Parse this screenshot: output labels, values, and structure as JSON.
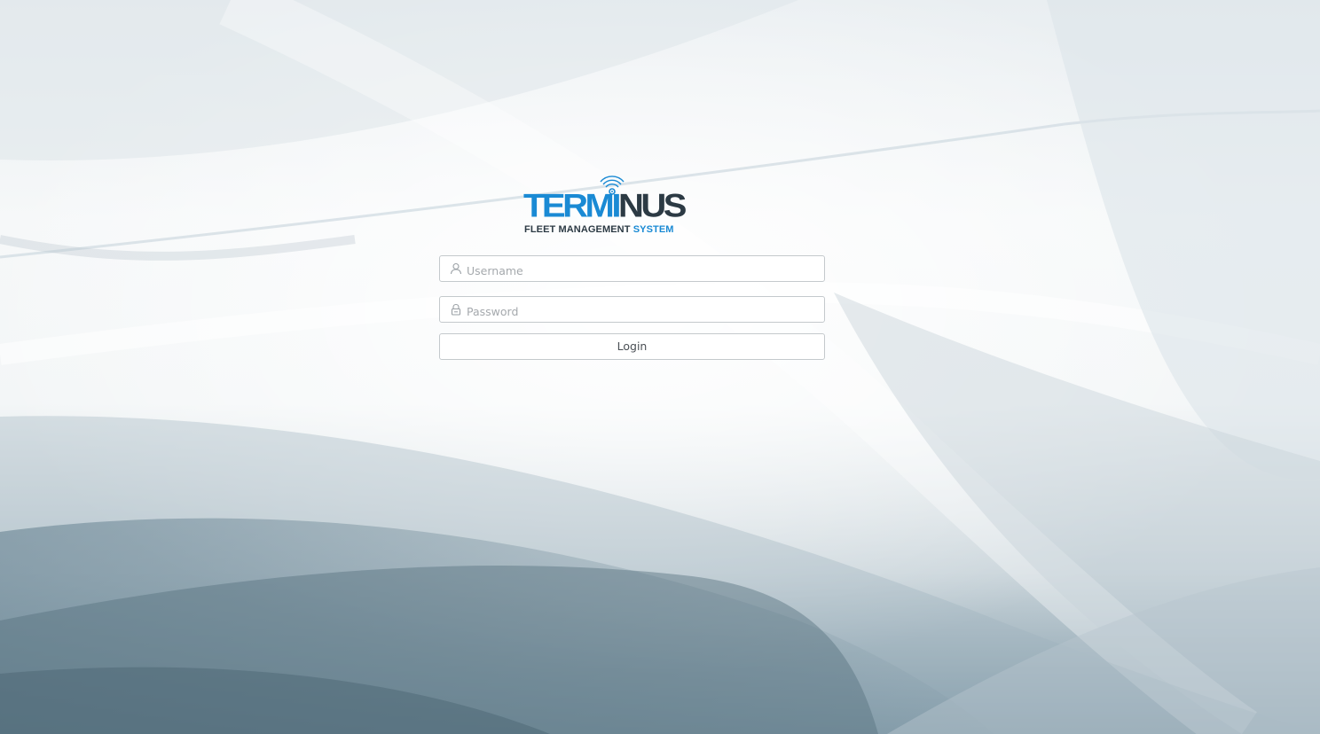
{
  "logo": {
    "word_blue": "TERM",
    "word_i": "I",
    "word_dark": "NUS",
    "sub_dark": "FLEET MANAGEMENT",
    "sub_blue": "SYSTEM",
    "icon": "signal-icon"
  },
  "form": {
    "username_placeholder": "Username",
    "username_value": "",
    "username_icon": "user-icon",
    "password_placeholder": "Password",
    "password_value": "",
    "password_icon": "lock-icon",
    "login_label": "Login"
  },
  "colors": {
    "brand_blue": "#1a8ad4",
    "brand_dark": "#2c3a44",
    "field_border": "#c4c9cc",
    "placeholder": "#a5a9ad"
  }
}
